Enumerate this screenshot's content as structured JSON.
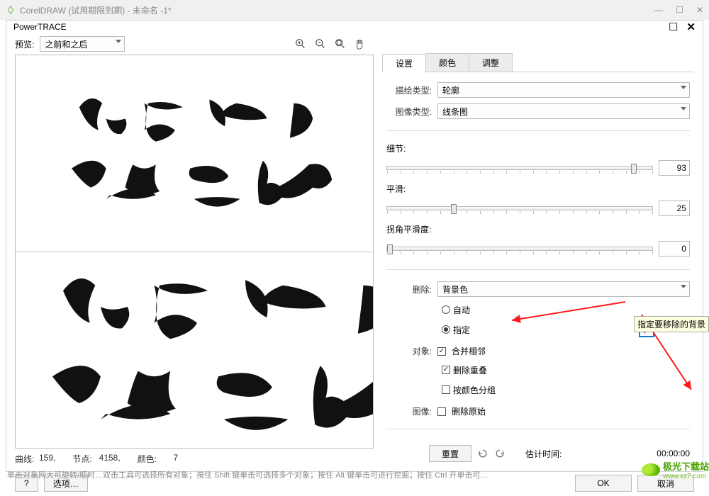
{
  "app": {
    "title": "CorelDRAW (试用期限到期) - 未命名 -1*"
  },
  "dialog": {
    "title": "PowerTRACE",
    "preview_label": "预览:",
    "preview_mode": "之前和之后"
  },
  "status": {
    "curves_label": "曲线:",
    "curves_value": "159,",
    "nodes_label": "节点:",
    "nodes_value": "4158,",
    "colors_label": "颜色:",
    "colors_value": "7"
  },
  "tabs": {
    "settings": "设置",
    "colors": "颜色",
    "adjust": "调整"
  },
  "settings": {
    "trace_type_label": "描绘类型:",
    "trace_type_value": "轮廓",
    "image_type_label": "图像类型:",
    "image_type_value": "线条图",
    "detail_label": "细节:",
    "detail_value": "93",
    "smooth_label": "平滑:",
    "smooth_value": "25",
    "corner_label": "拐角平滑度:",
    "corner_value": "0",
    "delete_label": "删除:",
    "delete_value": "背景色",
    "auto": "自动",
    "specify": "指定",
    "objects_label": "对象:",
    "merge_adj": "合并相邻",
    "remove_overlap": "删除重叠",
    "group_by_color": "按颜色分组",
    "image_label": "图像:",
    "remove_original": "删除原始",
    "reset": "重置",
    "est_label": "估计时间:",
    "est_value": "00:00:00",
    "tooltip": "指定要移除的背景"
  },
  "footer": {
    "help": "?",
    "options": "选项…",
    "ok": "OK",
    "cancel": "取消"
  },
  "hint": "单击对象网大可旋转/顺时…双击工具可选择所有对象；按住 Shift 键单击可选择多个对象；按住 Alt 键单击可进行挖掘；按住 Ctrl 开单击可…",
  "watermark": {
    "text": "极光下载站",
    "url": "www.xz7.com"
  }
}
